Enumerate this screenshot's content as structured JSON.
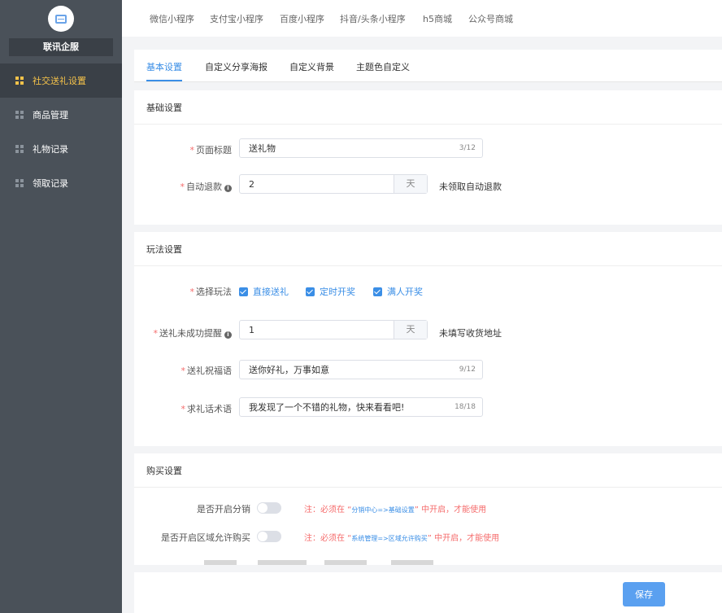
{
  "sidebar": {
    "brand": "联讯企服",
    "items": [
      {
        "label": "社交送礼设置",
        "active": true
      },
      {
        "label": "商品管理"
      },
      {
        "label": "礼物记录"
      },
      {
        "label": "领取记录"
      }
    ]
  },
  "top_tabs": [
    "微信小程序",
    "支付宝小程序",
    "百度小程序",
    "抖音/头条小程序",
    "h5商城",
    "公众号商城"
  ],
  "sub_tabs": [
    "基本设置",
    "自定义分享海报",
    "自定义背景",
    "主题色自定义"
  ],
  "basic": {
    "title": "基础设置",
    "page_title_label": "页面标题",
    "page_title_value": "送礼物",
    "page_title_count": "3/12",
    "refund_label": "自动退款",
    "refund_value": "2",
    "refund_unit": "天",
    "refund_suffix": "未领取自动退款"
  },
  "play": {
    "title": "玩法设置",
    "mode_label": "选择玩法",
    "modes": [
      "直接送礼",
      "定时开奖",
      "满人开奖"
    ],
    "remind_label": "送礼未成功提醒",
    "remind_value": "1",
    "remind_unit": "天",
    "remind_suffix": "未填写收货地址",
    "blessing_label": "送礼祝福语",
    "blessing_value": "送你好礼，万事如意",
    "blessing_count": "9/12",
    "ask_label": "求礼话术语",
    "ask_value": "我发现了一个不错的礼物，快来看看吧!",
    "ask_count": "18/18"
  },
  "buy": {
    "title": "购买设置",
    "distribution_label": "是否开启分销",
    "distribution_note_prefix": "注：必须在 “",
    "distribution_note_link": "分销中心=>基础设置",
    "distribution_note_suffix": "” 中开启，才能使用",
    "region_label": "是否开启区域允许购买",
    "region_note_prefix": "注：必须在 “",
    "region_note_link": "系统管理=>区域允许购买",
    "region_note_suffix": "” 中开启，才能使用"
  },
  "footer": {
    "save": "保存"
  }
}
